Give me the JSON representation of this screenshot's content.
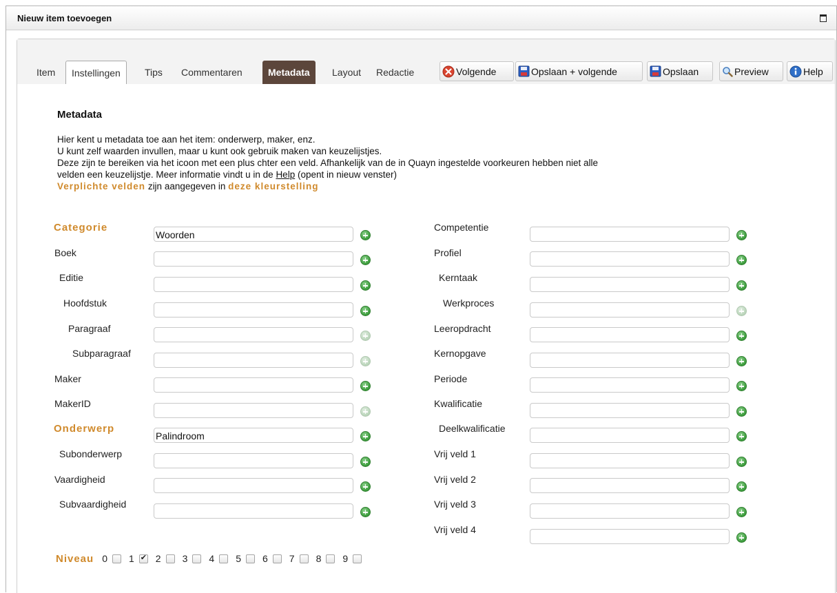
{
  "window": {
    "title": "Nieuw item toevoegen"
  },
  "tabs": [
    {
      "label": "Item"
    },
    {
      "label": "Instellingen"
    },
    {
      "label": "Tips"
    },
    {
      "label": "Commentaren"
    },
    {
      "label": "Metadata"
    },
    {
      "label": "Layout"
    },
    {
      "label": "Redactie"
    }
  ],
  "active_tab": "Metadata",
  "toolbar": {
    "volgende": "Volgende",
    "opslaan_volgende": "Opslaan + volgende",
    "opslaan": "Opslaan",
    "preview": "Preview",
    "help": "Help"
  },
  "metadata": {
    "heading": "Metadata",
    "intro_1": "Hier kent u metadata toe aan het item: onderwerp, maker, enz.",
    "intro_2": "U kunt zelf waarden invullen, maar u kunt ook gebruik maken van keuzelijstjes.",
    "intro_3": "Deze zijn te bereiken via het icoon met een plus chter een veld. Afhankelijk van de in Quayn ingestelde voorkeuren hebben niet alle",
    "intro_4a": "velden een keuzelijstje. Meer informatie vindt u in de",
    "intro_4_link": "Help",
    "intro_4b": "(opent in nieuw venster)",
    "req_1": "Verplichte velden",
    "req_mid": "zijn aangegeven in",
    "req_2": "deze kleurstelling"
  },
  "left_fields": [
    {
      "label": "Categorie",
      "value": "Woorden"
    },
    {
      "label": "Boek",
      "value": ""
    },
    {
      "label": "Editie",
      "value": ""
    },
    {
      "label": "Hoofdstuk",
      "value": ""
    },
    {
      "label": "Paragraaf",
      "value": ""
    },
    {
      "label": "Subparagraaf",
      "value": ""
    },
    {
      "label": "Maker",
      "value": ""
    },
    {
      "label": "MakerID",
      "value": ""
    },
    {
      "label": "Onderwerp",
      "value": "Palindroom"
    },
    {
      "label": "Subonderwerp",
      "value": ""
    },
    {
      "label": "Vaardigheid",
      "value": ""
    },
    {
      "label": "Subvaardigheid",
      "value": ""
    }
  ],
  "right_fields": [
    {
      "label": "Competentie",
      "value": ""
    },
    {
      "label": "Profiel",
      "value": ""
    },
    {
      "label": "Kerntaak",
      "value": ""
    },
    {
      "label": "Werkproces",
      "value": ""
    },
    {
      "label": "Leeropdracht",
      "value": ""
    },
    {
      "label": "Kernopgave",
      "value": ""
    },
    {
      "label": "Periode",
      "value": ""
    },
    {
      "label": "Kwalificatie",
      "value": ""
    },
    {
      "label": "Deelkwalificatie",
      "value": ""
    },
    {
      "label": "Vrij veld 1",
      "value": ""
    },
    {
      "label": "Vrij veld 2",
      "value": ""
    },
    {
      "label": "Vrij veld 3",
      "value": ""
    },
    {
      "label": "Vrij veld 4",
      "value": ""
    }
  ],
  "niveau": {
    "label": "Niveau",
    "levels": [
      "0",
      "1",
      "2",
      "3",
      "4",
      "5",
      "6",
      "7",
      "8",
      "9"
    ],
    "checked": [
      "1"
    ]
  },
  "colors": {
    "required": "#d08a2c",
    "active_tab": "#5c463b",
    "plus_icon": "#3b9b3b"
  }
}
